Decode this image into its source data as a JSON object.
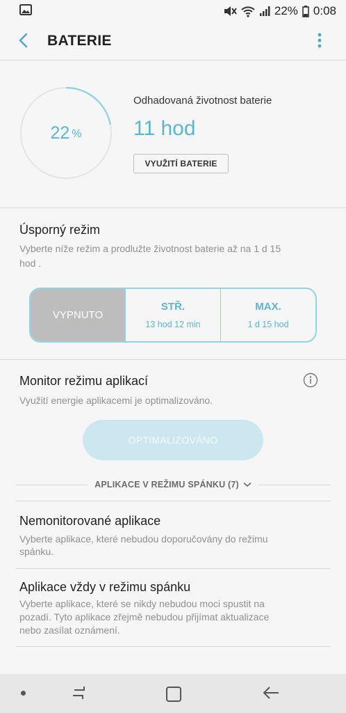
{
  "status_bar": {
    "battery": "22%",
    "time": "0:08",
    "icons": [
      "image-icon",
      "mute-icon",
      "wifi-icon",
      "signal-icon",
      "battery-icon"
    ]
  },
  "header": {
    "title": "BATERIE",
    "icons": [
      "back-arrow-icon",
      "more-vert-icon"
    ]
  },
  "battery": {
    "percent": "22",
    "percent_unit": "%",
    "level": 0.22,
    "estimate_label": "Odhadovaná životnost baterie",
    "estimate_value": "11 hod",
    "usage_button": "VYUŽITÍ BATERIE"
  },
  "power_saving": {
    "title": "Úsporný režim",
    "description_line1": "Vyberte níže režim a prodlužte životnost baterie až na 1 d 15",
    "description_line2": "hod .",
    "modes": [
      {
        "label": "VYPNUTO",
        "sub": "",
        "active": true
      },
      {
        "label": "STŘ.",
        "sub": "13 hod 12 min",
        "active": false
      },
      {
        "label": "MAX.",
        "sub": "1 d 15 hod",
        "active": false
      }
    ]
  },
  "app_monitor": {
    "title": "Monitor režimu aplikací",
    "description": "Využití energie aplikacemi je optimalizováno.",
    "button": "OPTIMALIZOVÁNO",
    "sleeping_apps": "APLIKACE V REŽIMU SPÁNKU (7)"
  },
  "unmonitored": {
    "title": "Nemonitorované aplikace",
    "description_line1": "Vyberte aplikace, které nebudou doporučovány do režimu",
    "description_line2": "spánku."
  },
  "always_sleep": {
    "title": "Aplikace vždy v režimu spánku",
    "description_line1": "Vyberte aplikace, které se nikdy nebudou moci spustit na",
    "description_line2": "pozadí. Tyto aplikace zřejmě nebudou přijímat aktualizace",
    "description_line3": "nebo zasílat oznámení."
  },
  "colors": {
    "accent": "#5bb6cf",
    "segment_border": "#8fd3e4",
    "active_segment": "#bdbdbd",
    "optimized_button": "#cde7f0"
  }
}
